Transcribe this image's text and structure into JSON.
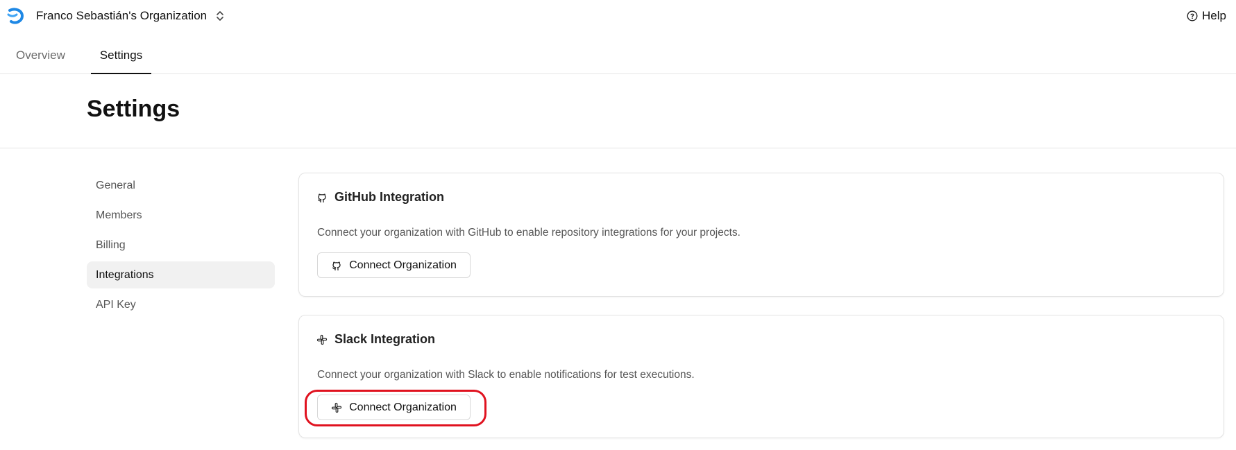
{
  "topbar": {
    "org_name": "Franco Sebastián's Organization",
    "help_label": "Help"
  },
  "tabs": [
    {
      "label": "Overview",
      "active": false
    },
    {
      "label": "Settings",
      "active": true
    }
  ],
  "page": {
    "title": "Settings"
  },
  "sidebar": {
    "items": [
      {
        "label": "General",
        "active": false
      },
      {
        "label": "Members",
        "active": false
      },
      {
        "label": "Billing",
        "active": false
      },
      {
        "label": "Integrations",
        "active": true
      },
      {
        "label": "API Key",
        "active": false
      }
    ]
  },
  "integrations": {
    "github": {
      "title": "GitHub Integration",
      "description": "Connect your organization with GitHub to enable repository integrations for your projects.",
      "button_label": "Connect Organization",
      "icon": "github-icon"
    },
    "slack": {
      "title": "Slack Integration",
      "description": "Connect your organization with Slack to enable notifications for test executions.",
      "button_label": "Connect Organization",
      "icon": "slack-icon"
    }
  },
  "colors": {
    "accent_logo": "#1e88e5",
    "highlight": "#e0121f",
    "active_bg": "#f1f1f1"
  }
}
